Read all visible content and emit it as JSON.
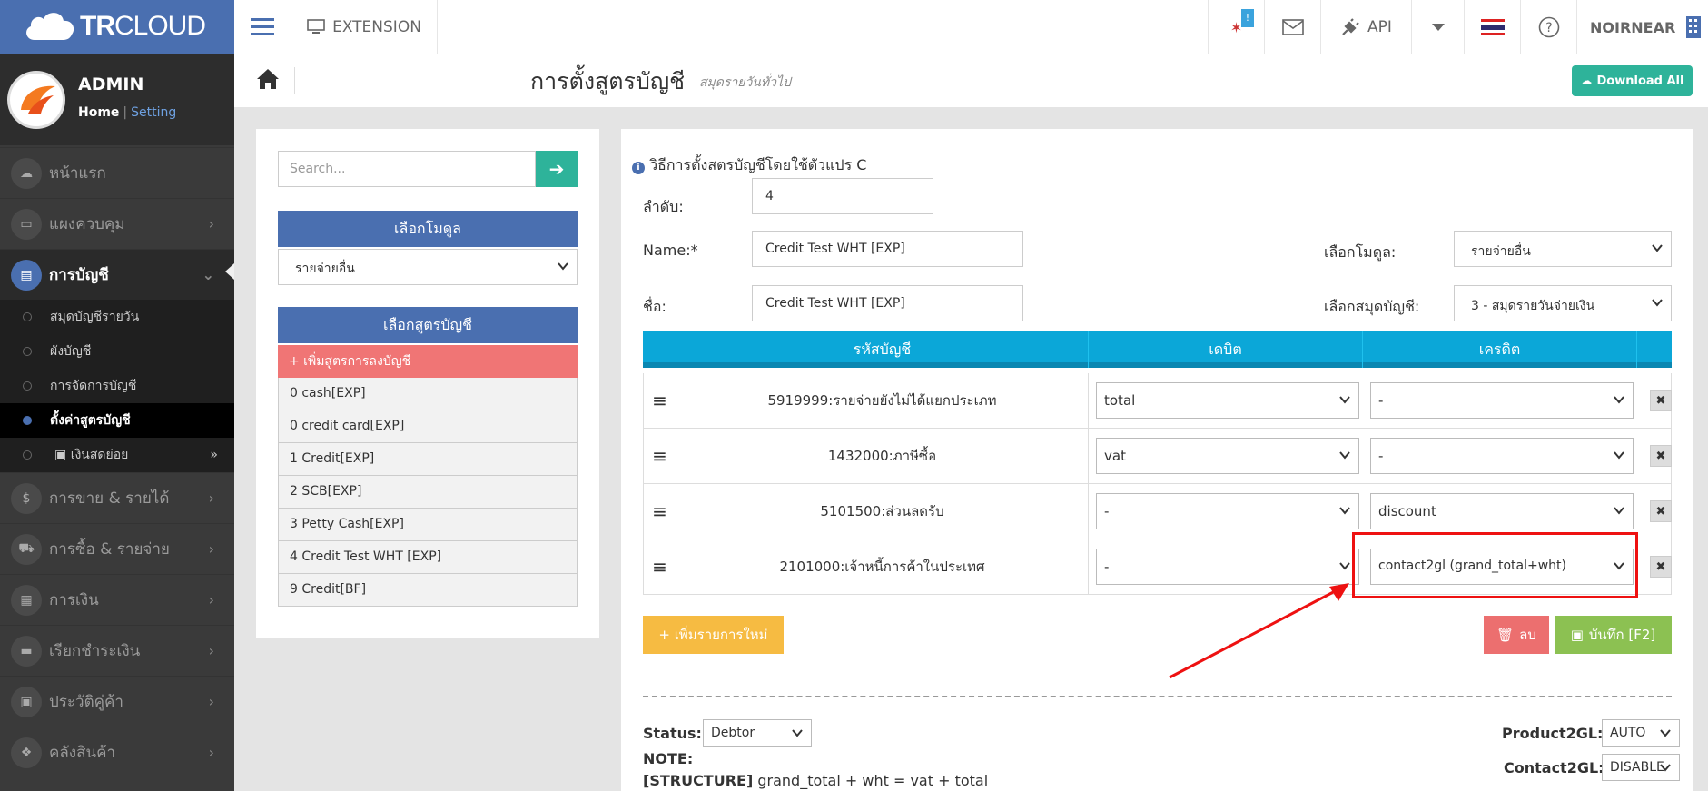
{
  "brand": {
    "part1": "TR",
    "part2": "CLOUD"
  },
  "profile": {
    "name": "ADMIN",
    "home": "Home",
    "separator": "|",
    "setting": "Setting"
  },
  "sidebar": {
    "items": [
      {
        "label": "หน้าแรก",
        "icon": "cloud-icon"
      },
      {
        "label": "แผงควบคุม",
        "icon": "monitor-icon"
      },
      {
        "label": "การบัญชี",
        "icon": "book-icon"
      },
      {
        "label": "การขาย & รายได้",
        "icon": "dollar-icon"
      },
      {
        "label": "การซื้อ & รายจ่าย",
        "icon": "cart-icon"
      },
      {
        "label": "การเงิน",
        "icon": "calendar-icon"
      },
      {
        "label": "เรียกชำระเงิน",
        "icon": "card-icon"
      },
      {
        "label": "ประวัติคู่ค้า",
        "icon": "address-book-icon"
      },
      {
        "label": "คลังสินค้า",
        "icon": "cubes-icon"
      }
    ],
    "subitems": [
      {
        "label": "สมุดบัญชีรายวัน"
      },
      {
        "label": "ผังบัญชี"
      },
      {
        "label": "การจัดการบัญชี"
      },
      {
        "label": "ตั้งค่าสูตรบัญชี"
      },
      {
        "label": "เงินสดย่อย"
      }
    ]
  },
  "topbar": {
    "extension": "EXTENSION",
    "notif_badge": "!",
    "api": "API",
    "user": "NOIRNEAR"
  },
  "page": {
    "title": "การตั้งสูตรบัญชี",
    "subtitle": "สมุดรายวันทั่วไป",
    "download": "Download All"
  },
  "left": {
    "search_placeholder": "Search...",
    "module_head": "เลือกโมดูล",
    "module_value": "รายจ่ายอื่น",
    "formula_head": "เลือกสูตรบัญชี",
    "add_formula": "+ เพิ่มสูตรการลงบัญชี",
    "formulas": [
      "0 cash[EXP]",
      "0 credit card[EXP]",
      "1 Credit[EXP]",
      "2 SCB[EXP]",
      "3 Petty Cash[EXP]",
      "4 Credit Test WHT [EXP]",
      "9 Credit[BF]"
    ]
  },
  "form": {
    "info": "วิธีการตั้งสตรบัญชีโดยใช้ตัวแปร C",
    "order_label": "ลำดับ:",
    "order_value": "4",
    "name_label": "Name:*",
    "name_value": "Credit Test WHT [EXP]",
    "thname_label": "ชื่อ:",
    "thname_value": "Credit Test WHT [EXP]",
    "module_label": "เลือกโมดูล:",
    "module_value": "รายจ่ายอื่น",
    "journal_label": "เลือกสมุดบัญชี:",
    "journal_value": "3 - สมุดรายวันจ่ายเงิน"
  },
  "table": {
    "headers": [
      "รหัสบัญชี",
      "เดบิต",
      "เครดิต"
    ],
    "rows": [
      {
        "account": "5919999:รายจ่ายยังไม่ได้แยกประเภท",
        "debit": "total",
        "credit": "-"
      },
      {
        "account": "1432000:ภาษีซื้อ",
        "debit": "vat",
        "credit": "-"
      },
      {
        "account": "5101500:ส่วนลดรับ",
        "debit": "-",
        "credit": "discount"
      },
      {
        "account": "2101000:เจ้าหนี้การค้าในประเทศ",
        "debit": "-",
        "credit": "contact2gl (grand_total+wht)"
      }
    ]
  },
  "actions": {
    "add_row": "+ เพิ่มรายการใหม่",
    "delete": "ลบ",
    "save": "บันทึก [F2]"
  },
  "footer": {
    "status_label": "Status:",
    "status_value": "Debtor",
    "note_label": "NOTE:",
    "structure_tag": "[STRUCTURE]",
    "structure_text": "grand_total + wht = vat + total",
    "p2gl_label": "Product2GL:",
    "p2gl_value": "AUTO",
    "c2gl_label": "Contact2GL:",
    "c2gl_value": "DISABLE"
  },
  "colors": {
    "brand": "#4a6fb0",
    "teal": "#2eb39a",
    "header": "#0ba7d8",
    "highlight": "#ee1111"
  }
}
